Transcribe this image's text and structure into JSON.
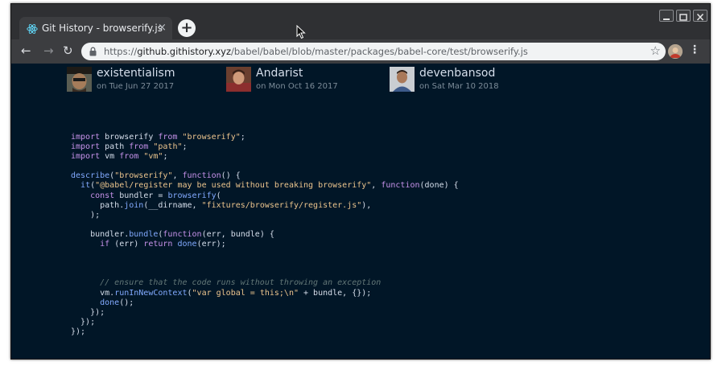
{
  "browser": {
    "tab": {
      "title": "Git History - browserify.js",
      "close": "×"
    },
    "new_tab": "+",
    "url": {
      "scheme": "https://",
      "host": "github.githistory.xyz",
      "path": "/babel/babel/blob/master/packages/babel-core/test/browserify.js"
    },
    "icons": [
      "react-icon",
      "close-icon",
      "plus-icon",
      "back-arrow-icon",
      "forward-arrow-icon",
      "reload-icon",
      "lock-icon",
      "star-icon",
      "profile-avatar-icon",
      "kebab-menu-icon",
      "minimize-icon",
      "maximize-icon",
      "close-window-icon",
      "mouse-cursor-icon"
    ]
  },
  "authors": [
    {
      "name": "existentialism",
      "date": "on Tue Jun 27 2017"
    },
    {
      "name": "Andarist",
      "date": "on Mon Oct 16 2017"
    },
    {
      "name": "devenbansod",
      "date": "on Sat Mar 10 2018"
    }
  ],
  "code_lines": [
    [
      [
        "kw",
        "import"
      ],
      [
        "p",
        " browserify "
      ],
      [
        "kw",
        "from"
      ],
      [
        "p",
        " "
      ],
      [
        "str",
        "\"browserify\""
      ],
      [
        "p",
        ";"
      ]
    ],
    [
      [
        "kw",
        "import"
      ],
      [
        "p",
        " path "
      ],
      [
        "kw",
        "from"
      ],
      [
        "p",
        " "
      ],
      [
        "str",
        "\"path\""
      ],
      [
        "p",
        ";"
      ]
    ],
    [
      [
        "kw",
        "import"
      ],
      [
        "p",
        " vm "
      ],
      [
        "kw",
        "from"
      ],
      [
        "p",
        " "
      ],
      [
        "str",
        "\"vm\""
      ],
      [
        "p",
        ";"
      ]
    ],
    [],
    [
      [
        "fn",
        "describe"
      ],
      [
        "p",
        "("
      ],
      [
        "str",
        "\"browserify\""
      ],
      [
        "p",
        ", "
      ],
      [
        "kw",
        "function"
      ],
      [
        "p",
        "() {"
      ]
    ],
    [
      [
        "p",
        "  "
      ],
      [
        "fn",
        "it"
      ],
      [
        "p",
        "("
      ],
      [
        "str",
        "\"@babel/register may be used without breaking browserify\""
      ],
      [
        "p",
        ", "
      ],
      [
        "kw",
        "function"
      ],
      [
        "p",
        "(done) {"
      ]
    ],
    [
      [
        "p",
        "    "
      ],
      [
        "kw",
        "const"
      ],
      [
        "p",
        " bundler = "
      ],
      [
        "fn",
        "browserify"
      ],
      [
        "p",
        "("
      ]
    ],
    [
      [
        "p",
        "      path."
      ],
      [
        "fn",
        "join"
      ],
      [
        "p",
        "(__dirname, "
      ],
      [
        "str",
        "\"fixtures/browserify/register.js\""
      ],
      [
        "p",
        "),"
      ]
    ],
    [
      [
        "p",
        "    );"
      ]
    ],
    [],
    [
      [
        "p",
        "    bundler."
      ],
      [
        "fn",
        "bundle"
      ],
      [
        "p",
        "("
      ],
      [
        "kw",
        "function"
      ],
      [
        "p",
        "(err, bundle) {"
      ]
    ],
    [
      [
        "p",
        "      "
      ],
      [
        "kw",
        "if"
      ],
      [
        "p",
        " (err) "
      ],
      [
        "kw",
        "return"
      ],
      [
        "p",
        " "
      ],
      [
        "fn",
        "done"
      ],
      [
        "p",
        "(err);"
      ]
    ],
    [],
    [],
    [],
    [
      [
        "p",
        "      "
      ],
      [
        "cmt",
        "// ensure that the code runs without throwing an exception"
      ]
    ],
    [
      [
        "p",
        "      vm."
      ],
      [
        "fn",
        "runInNewContext"
      ],
      [
        "p",
        "("
      ],
      [
        "str",
        "\"var global = this;\\n\""
      ],
      [
        "p",
        " + bundle, {});"
      ]
    ],
    [
      [
        "p",
        "      "
      ],
      [
        "fn",
        "done"
      ],
      [
        "p",
        "();"
      ]
    ],
    [
      [
        "p",
        "    });"
      ]
    ],
    [
      [
        "p",
        "  });"
      ]
    ],
    [
      [
        "p",
        "});"
      ]
    ]
  ]
}
